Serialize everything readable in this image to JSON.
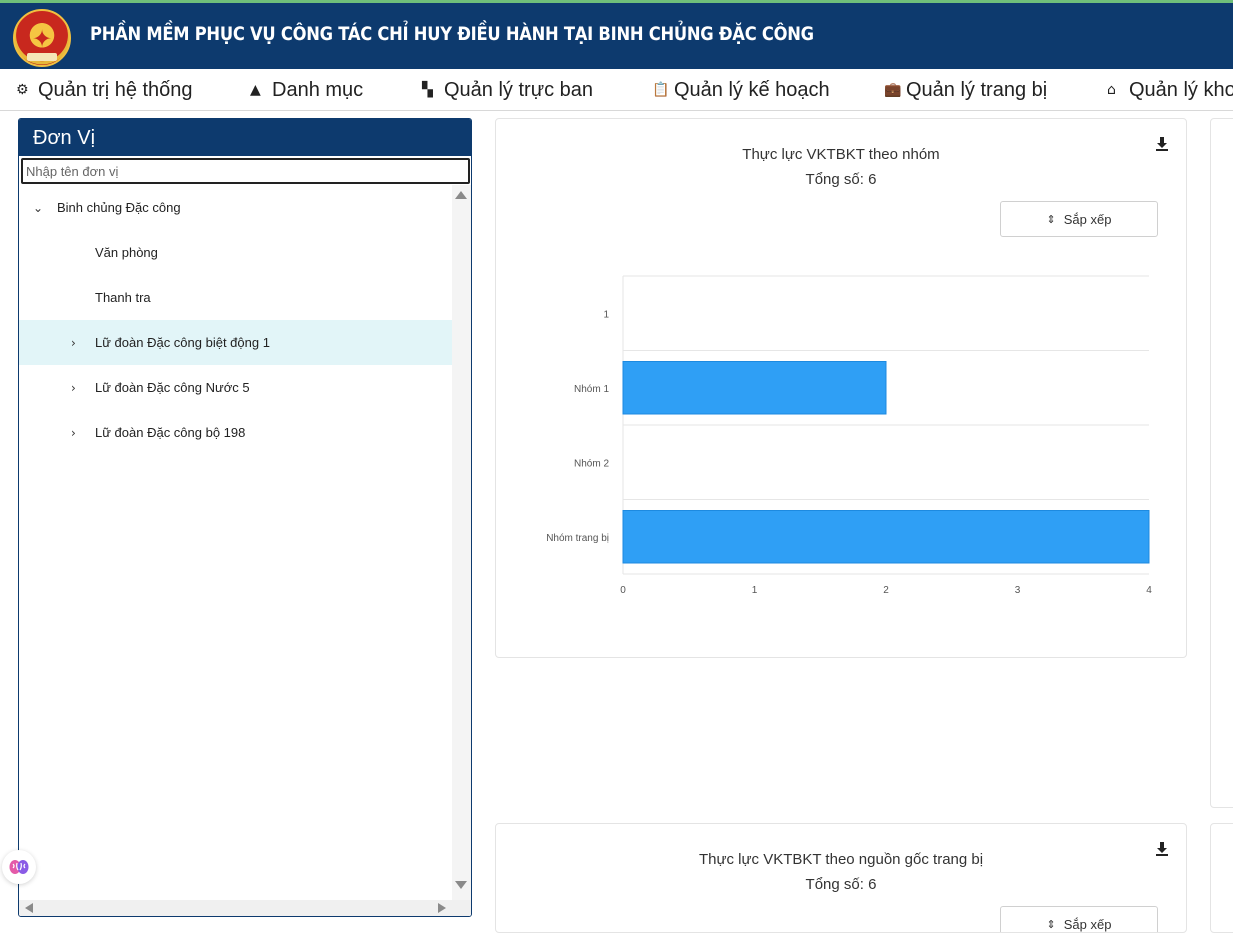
{
  "app": {
    "title": "PHẦN MỀM PHỤC VỤ CÔNG TÁC CHỈ HUY ĐIỀU HÀNH TẠI BINH CHỦNG ĐẶC CÔNG",
    "logo_text": "13-3-1967"
  },
  "menu": [
    {
      "label": "Quản trị hệ thống",
      "icon": "gear-icon"
    },
    {
      "label": "Danh mục",
      "icon": "shapes-icon"
    },
    {
      "label": "Quản lý trực ban",
      "icon": "dashboard-icon"
    },
    {
      "label": "Quản lý kế hoạch",
      "icon": "clipboard-clock-icon"
    },
    {
      "label": "Quản lý trang bị",
      "icon": "briefcase-icon"
    },
    {
      "label": "Quản lý kho",
      "icon": "warehouse-icon"
    }
  ],
  "unit_panel": {
    "title": "Đơn Vị",
    "search_placeholder": "Nhập tên đơn vị",
    "tree": [
      {
        "label": "Binh chủng Đặc công",
        "level": 0,
        "expander": "expanded",
        "selected": false
      },
      {
        "label": "Văn phòng",
        "level": 1,
        "expander": "none",
        "selected": false
      },
      {
        "label": "Thanh tra",
        "level": 1,
        "expander": "none",
        "selected": false
      },
      {
        "label": "Lữ đoàn Đặc công biệt động 1",
        "level": 1,
        "expander": "collapsed",
        "selected": true
      },
      {
        "label": "Lữ đoàn Đặc công Nước 5",
        "level": 1,
        "expander": "collapsed",
        "selected": false
      },
      {
        "label": "Lữ đoàn Đặc công bộ 198",
        "level": 1,
        "expander": "collapsed",
        "selected": false
      }
    ]
  },
  "cards": [
    {
      "title": "Thực lực VKTBKT theo nhóm",
      "total": "Tổng số: 6",
      "sort_label": "Sắp xếp"
    },
    {
      "title": "Thực lực VKTBKT theo nguồn gốc trang bị",
      "total": "Tổng số: 6",
      "sort_label": "Sắp xếp"
    }
  ],
  "colors": {
    "header_bg": "#0d3a6e",
    "bar": "#2f9ff5",
    "selected_row": "#e2f5f8"
  },
  "chart_data": {
    "type": "bar",
    "orientation": "horizontal",
    "title": "Thực lực VKTBKT theo nhóm",
    "subtitle": "Tổng số: 6",
    "categories": [
      "1",
      "Nhóm 1",
      "Nhóm 2",
      "Nhóm trang bị"
    ],
    "values": [
      0,
      2,
      0,
      4
    ],
    "xlim": [
      0,
      4
    ],
    "x_ticks": [
      0,
      1,
      2,
      3,
      4
    ],
    "grid": true,
    "xlabel": "",
    "ylabel": ""
  }
}
